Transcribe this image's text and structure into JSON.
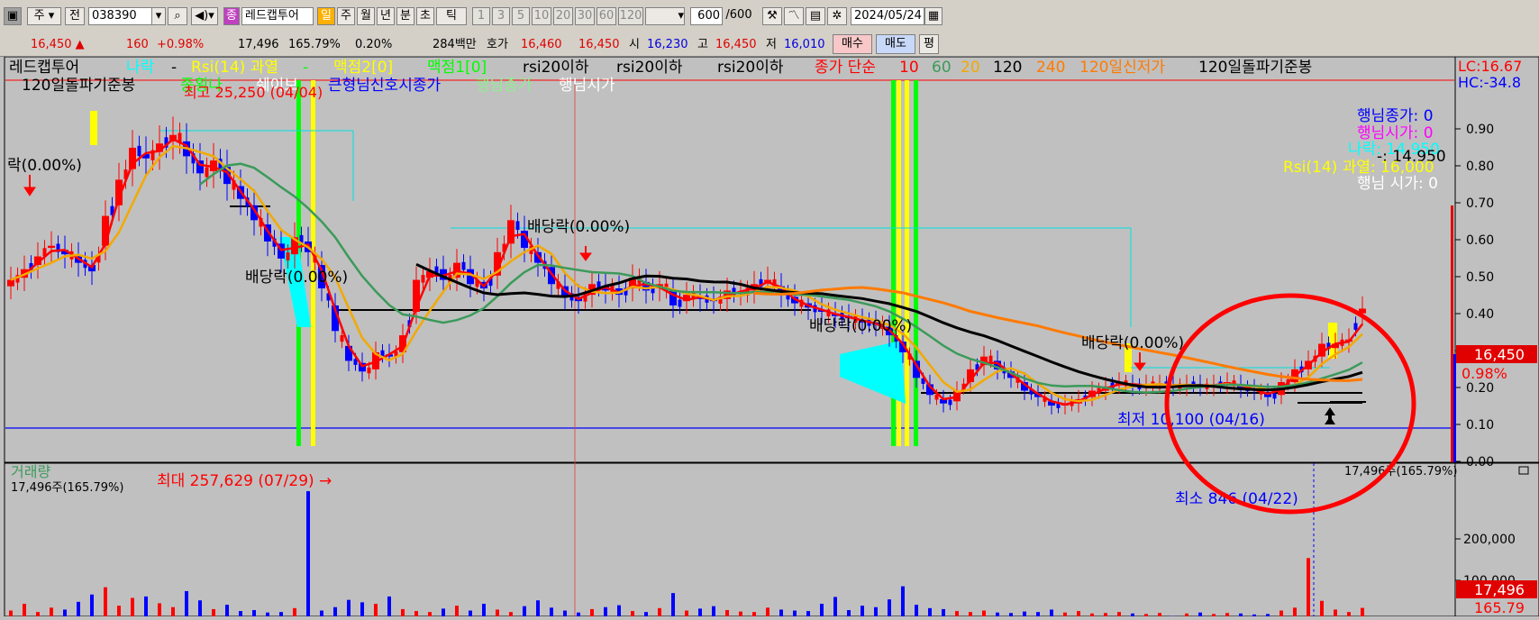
{
  "toolbar": {
    "type_select": "주",
    "prev_label": "전",
    "code": "038390",
    "stock_name": "레드캡투어",
    "stock_badge": "종",
    "periods": [
      "일",
      "주",
      "월",
      "년",
      "분",
      "초",
      "틱"
    ],
    "minutes": [
      "1",
      "3",
      "5",
      "10",
      "20",
      "30",
      "60",
      "120"
    ],
    "count_value": "600",
    "count_total": "/600",
    "date": "2024/05/24"
  },
  "quote": {
    "price": "16,450 ▲",
    "change": "160",
    "change_pct": "+0.98%",
    "volume": "17,496",
    "volume_pct": "165.79%",
    "turnover_pct": "0.20%",
    "amount": "284백만",
    "ask_label": "호가",
    "ask1": "16,460",
    "bid1": "16,450",
    "open_label": "시",
    "open": "16,230",
    "high_label": "고",
    "high": "16,450",
    "low_label": "저",
    "low": "16,010",
    "buy_label": "매수",
    "sell_label": "매도",
    "eval_label": "평"
  },
  "colors": {
    "up": "#ff0000",
    "down": "#0000ff",
    "ma10": "#ff0000",
    "ma20": "#f2a900",
    "ma60": "#3c9a5a",
    "ma120": "#000000",
    "ma240": "#ff7a00",
    "annotation_circle": "#ff0000"
  },
  "chart_data": [
    {
      "type": "candlestick",
      "title": "레드캡투어",
      "legend": [
        {
          "label": "나락",
          "color": "#00ffff"
        },
        {
          "label": "-",
          "color": "#000000"
        },
        {
          "label": "Rsi(14) 과열",
          "color": "#ffff00"
        },
        {
          "label": "-",
          "color": "#00ff00"
        },
        {
          "label": "맥점2[0]",
          "color": "#ffff00"
        },
        {
          "label": "맥점1[0]",
          "color": "#00ff00"
        },
        {
          "label": "rsi20이하",
          "color": "#000000"
        },
        {
          "label": "rsi20이하",
          "color": "#000000"
        },
        {
          "label": "rsi20이하",
          "color": "#000000"
        },
        {
          "label": "종가 단순",
          "color": "#ff0000"
        },
        {
          "label": "10",
          "color": "#ff0000"
        },
        {
          "label": "60",
          "color": "#3c9a5a"
        },
        {
          "label": "20",
          "color": "#f2a900"
        },
        {
          "label": "120",
          "color": "#000000"
        },
        {
          "label": "240",
          "color": "#ff7a00"
        },
        {
          "label": "120일신저가",
          "color": "#ff7a00"
        },
        {
          "label": "120일돌파기준봉",
          "color": "#000000"
        },
        {
          "label": "120일돌파기준봉",
          "color": "#000000"
        },
        {
          "label": "종횡나",
          "color": "#00ff00"
        },
        {
          "label": "쉐이보",
          "color": "#ffffff"
        },
        {
          "label": "큰형님신호시종가",
          "color": "#0000ff"
        },
        {
          "label": "행님종가",
          "color": "#90ee90"
        },
        {
          "label": "행님시가",
          "color": "#ffffff"
        }
      ],
      "y_right_ticks": [
        "0.90",
        "0.80",
        "0.70",
        "0.60",
        "0.50",
        "0.40",
        "0.30",
        "0.20",
        "0.10",
        "0.00"
      ],
      "y_right_range": [
        0,
        0.95
      ],
      "price_scale_note": "approximate price in KRW: 10,000 at bottom baseline, ~27,000 at top",
      "close_series": [
        17800,
        18300,
        18900,
        19400,
        19000,
        18600,
        18200,
        20800,
        22500,
        24000,
        23500,
        24200,
        24600,
        23600,
        22800,
        23400,
        22300,
        21600,
        20600,
        19600,
        18800,
        19800,
        19100,
        17400,
        15400,
        14000,
        13500,
        14400,
        14200,
        15200,
        17800,
        18200,
        17800,
        18600,
        17600,
        17400,
        19100,
        20600,
        19300,
        18600,
        17600,
        17000,
        16800,
        17600,
        17300,
        17100,
        17900,
        17300,
        17600,
        16600,
        17100,
        16900,
        16800,
        17300,
        17200,
        17600,
        17800,
        17100,
        16700,
        16500,
        16300,
        16100,
        16000,
        15800,
        15700,
        15200,
        14400,
        13200,
        12400,
        12000,
        12600,
        13600,
        14200,
        13600,
        13200,
        12600,
        12300,
        11900,
        12000,
        12200,
        12600,
        12800,
        13000,
        12800,
        12900,
        12900,
        12800,
        12900,
        12800,
        12900,
        13000,
        12700,
        12600,
        12300,
        13000,
        13600,
        14000,
        14800,
        14800,
        15000,
        16450
      ],
      "open_series": [
        17500,
        17900,
        18500,
        19300,
        19200,
        18900,
        18500,
        19400,
        21300,
        23000,
        23700,
        23800,
        24300,
        24300,
        23400,
        22900,
        23100,
        22200,
        21300,
        20400,
        19500,
        19000,
        19600,
        18500,
        16600,
        14700,
        13900,
        13600,
        14300,
        14400,
        16300,
        17900,
        18300,
        17900,
        18300,
        17700,
        18000,
        19500,
        20100,
        19100,
        18400,
        17500,
        17000,
        17100,
        17500,
        17400,
        17400,
        17700,
        17400,
        17300,
        16800,
        17000,
        16900,
        16900,
        17200,
        17300,
        17700,
        17500,
        17000,
        16700,
        16400,
        16200,
        16100,
        15900,
        15800,
        15600,
        14900,
        14000,
        12900,
        12200,
        12100,
        13000,
        13800,
        14000,
        13500,
        13000,
        12500,
        12100,
        11900,
        12000,
        12300,
        12600,
        12900,
        12900,
        12800,
        12900,
        12900,
        12800,
        12900,
        12800,
        12900,
        12900,
        12700,
        12500,
        12400,
        13000,
        13600,
        14200,
        14600,
        14900,
        16230
      ],
      "ma_periods": [
        10,
        20,
        60,
        120,
        240
      ],
      "volume": {
        "label": "거래량",
        "current_label": "17,496주(165.79%)",
        "current_value": 17496,
        "y_ticks": [
          "200,000",
          "100,000"
        ],
        "y_range": [
          0,
          280000
        ],
        "values": [
          12000,
          26000,
          9000,
          18000,
          14000,
          30000,
          45000,
          60000,
          22000,
          38000,
          41000,
          27000,
          19000,
          52000,
          33000,
          15000,
          24000,
          11000,
          13000,
          8000,
          9000,
          17000,
          257629,
          12000,
          19000,
          34000,
          29000,
          26000,
          41000,
          15000,
          11000,
          9000,
          16000,
          22000,
          12000,
          26000,
          14000,
          9000,
          21000,
          33000,
          18000,
          12000,
          8000,
          15000,
          19000,
          23000,
          11000,
          9000,
          17000,
          48000,
          12000,
          16000,
          21000,
          13000,
          10000,
          9000,
          18000,
          14000,
          12000,
          11000,
          26000,
          40000,
          13000,
          22000,
          19000,
          35000,
          62000,
          24000,
          17000,
          15000,
          11000,
          9000,
          12000,
          8000,
          7000,
          10000,
          9000,
          14000,
          8000,
          11000,
          6000,
          7000,
          9000,
          6000,
          5000,
          7000,
          846,
          6000,
          8000,
          5000,
          7000,
          6000,
          4000,
          5000,
          12000,
          18000,
          120000,
          32000,
          14000,
          9000,
          17496
        ]
      }
    }
  ],
  "annotations": {
    "max_label": "최고 25,250 (04/04)",
    "min_label": "최저 10,100 (04/16)",
    "vol_max_label": "최대 257,629 (07/29) →",
    "vol_min_label": "최소 846 (04/22)",
    "dividend_labels": [
      "락(0.00%)",
      "배당락(0.00%)",
      "배당락(0.00%)",
      "배당락(0.00%)",
      "배당락(0.00%)"
    ]
  },
  "right_panel": {
    "lc": "LC:16.67",
    "hc": "HC:-34.8",
    "price_tag": "16,450",
    "change_tag": "0.98%",
    "vol_tag": "17,496",
    "vol_pct_tag": "165.79",
    "overlay_labels": [
      "행님종가: 0",
      "행님시가: 0",
      "나락: 14.950",
      "-: 14.950",
      "Rsi(14) 과열: 16,000",
      "행님 시가: 0"
    ],
    "vol_header": "17,496주(165.79%)"
  }
}
